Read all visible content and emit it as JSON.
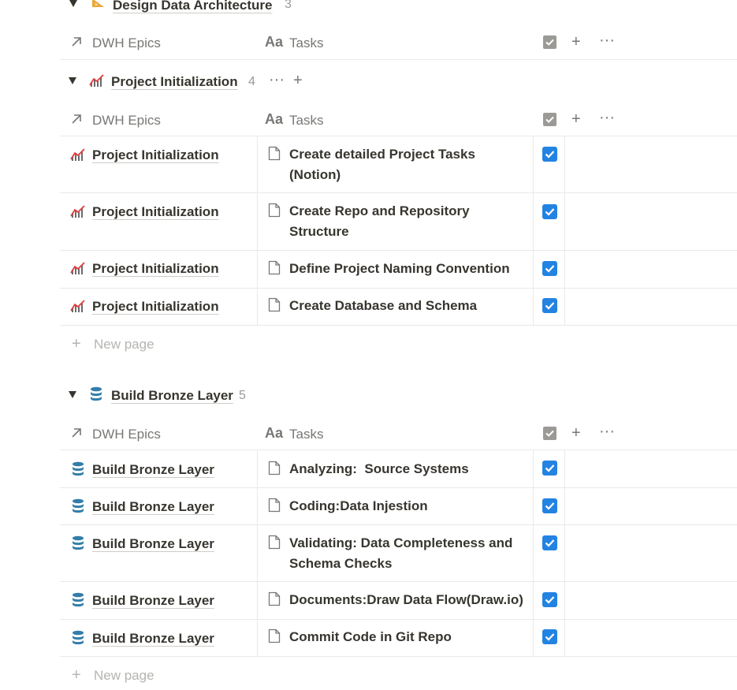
{
  "groups": {
    "design": {
      "title": "Design Data Architecture",
      "count": "3",
      "icon": "triangle-ruler-icon"
    },
    "init": {
      "title": "Project Initialization",
      "count": "4",
      "icon": "chart-icon"
    },
    "bronze": {
      "title": "Build Bronze Layer",
      "count": "5",
      "icon": "database-icon"
    }
  },
  "header": {
    "epics_label": "DWH Epics",
    "tasks_icon": "Aa",
    "tasks_label": "Tasks"
  },
  "init_rows": [
    {
      "epic": "Project Initialization",
      "task": "Create detailed Project Tasks (Notion)",
      "done": true
    },
    {
      "epic": "Project Initialization",
      "task": "Create Repo and Repository Structure",
      "done": true
    },
    {
      "epic": "Project Initialization",
      "task": "Define Project Naming Convention",
      "done": true
    },
    {
      "epic": "Project Initialization",
      "task": "Create Database and Schema",
      "done": true
    }
  ],
  "bronze_rows": [
    {
      "epic": "Build Bronze Layer",
      "task": "Analyzing:  Source Systems",
      "done": true
    },
    {
      "epic": "Build Bronze Layer",
      "task": "Coding:Data Injestion",
      "done": true
    },
    {
      "epic": "Build Bronze Layer",
      "task": "Validating: Data Completeness and Schema Checks",
      "done": true
    },
    {
      "epic": "Build Bronze Layer",
      "task": "Documents:Draw Data Flow(Draw.io)",
      "done": true
    },
    {
      "epic": "Build Bronze Layer",
      "task": "Commit Code in Git Repo",
      "done": true
    }
  ],
  "new_page_label": "New page",
  "colors": {
    "accent": "#2383e2",
    "db_icon": "#337ea9",
    "text": "#37352f",
    "muted": "#787774"
  }
}
